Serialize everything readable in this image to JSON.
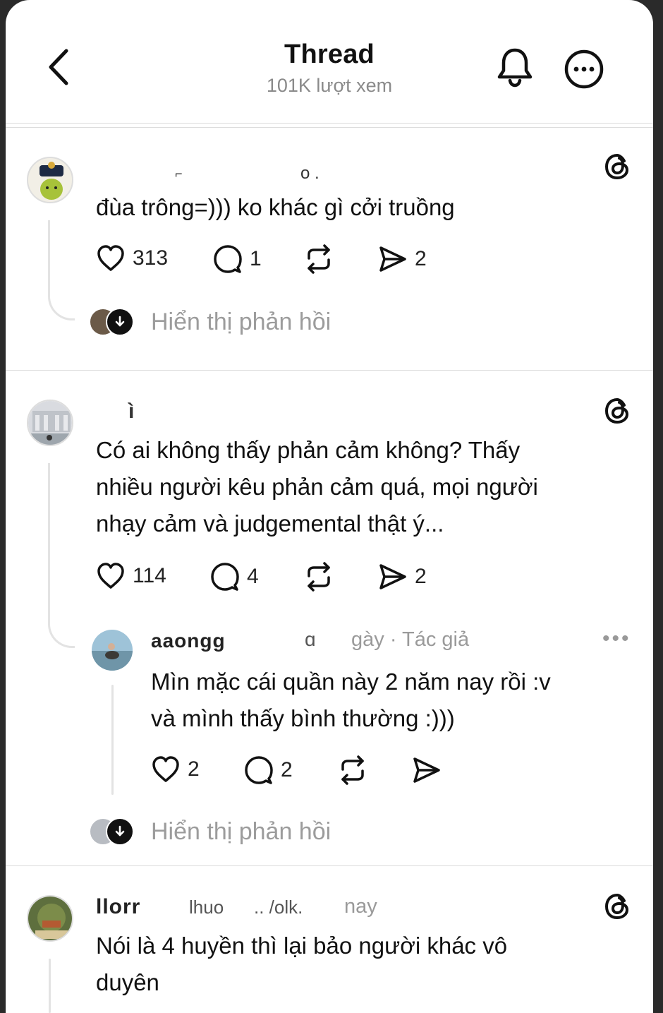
{
  "header": {
    "title": "Thread",
    "views": "101K lượt xem"
  },
  "posts": [
    {
      "username": "",
      "text": "đùa trông=))) ko khác gì cởi truồng",
      "likes": "313",
      "replies": "1",
      "reposts": "",
      "shares": "2",
      "show_replies": "Hiển thị phản hồi"
    },
    {
      "username": "",
      "text_lines": [
        "Có ai không thấy phản cảm không? Thấy",
        "nhiều người kêu phản cảm quá, mọi người",
        "nhạy cảm và judgemental thật ý..."
      ],
      "likes": "114",
      "replies": "4",
      "reposts": "",
      "shares": "2",
      "reply": {
        "username": "aaongg",
        "meta": "gày · Tác giả",
        "text_lines": [
          "Mìn mặc cái quần này 2 năm nay rồi :v",
          "và mình thấy bình thường :)))"
        ],
        "likes": "2",
        "replies": "2",
        "shares": ""
      },
      "show_replies": "Hiển thị phản hồi"
    },
    {
      "username": "llorr",
      "meta": "nay",
      "text_lines": [
        "Nói là 4 huyền thì lại bảo người khác vô",
        "duyên"
      ]
    }
  ],
  "colors": {
    "muted": "#9c9c9c",
    "divider": "#dcdcdc",
    "thread_line": "#e3e3e3"
  },
  "icons": [
    "chevron-left",
    "bell",
    "more-horizontal",
    "threads-logo",
    "heart",
    "comment",
    "repost",
    "share",
    "arrow-down"
  ]
}
